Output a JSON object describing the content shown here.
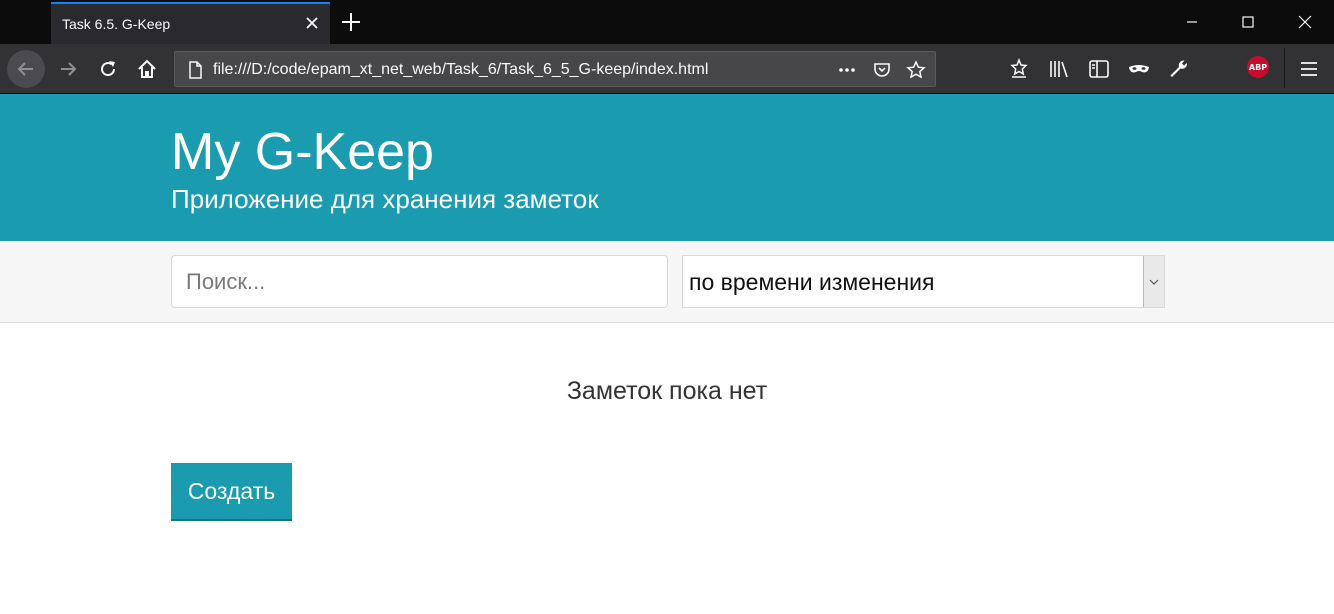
{
  "browser": {
    "tab_title": "Task 6.5. G-Keep",
    "url": "file:///D:/code/epam_xt_net_web/Task_6/Task_6_5_G-keep/index.html",
    "accent_color": "#0a84ff",
    "abp_label": "ABP"
  },
  "header": {
    "title": "My G-Keep",
    "subtitle": "Приложение для хранения заметок",
    "background": "#1a9bb0"
  },
  "toolbar": {
    "search_placeholder": "Поиск...",
    "sort_selected": "по времени изменения"
  },
  "main": {
    "empty_message": "Заметок пока нет",
    "create_label": "Создать"
  }
}
